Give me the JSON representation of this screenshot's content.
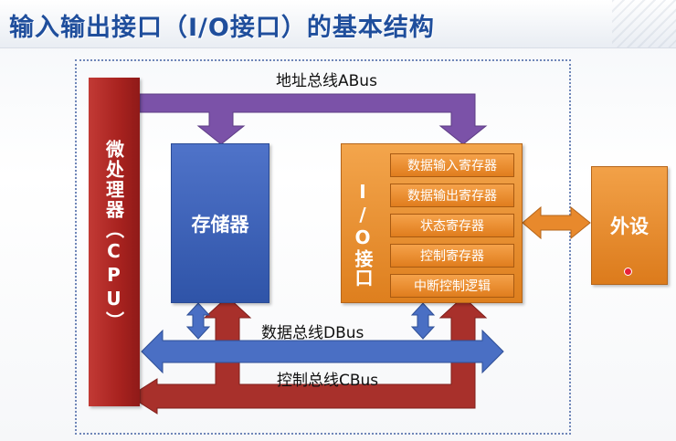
{
  "title": "输入输出接口（I/O接口）的基本结构",
  "cpu": {
    "label": "微处理器（CPU）"
  },
  "memory": {
    "label": "存储器"
  },
  "io_interface": {
    "label": "I/O接口",
    "registers": [
      "数据输入寄存器",
      "数据输出寄存器",
      "状态寄存器",
      "控制寄存器",
      "中断控制逻辑"
    ]
  },
  "peripheral": {
    "label": "外设"
  },
  "buses": {
    "address": "地址总线ABus",
    "data": "数据总线DBus",
    "control": "控制总线CBus"
  },
  "colors": {
    "address_bus": "#7b52a8",
    "data_bus": "#4a6fc4",
    "control_bus": "#a8302b",
    "cpu": "#b02a26",
    "memory": "#3b5fb5",
    "io": "#e8892c",
    "title": "#1f4e9c"
  }
}
